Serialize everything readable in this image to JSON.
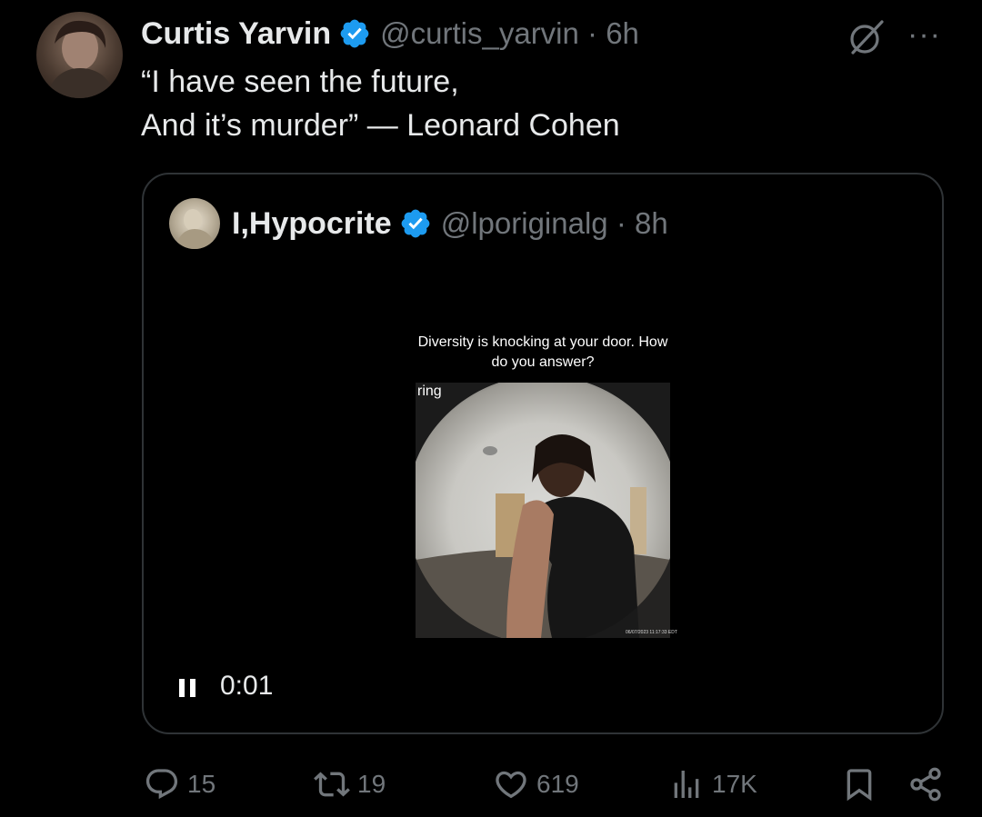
{
  "tweet": {
    "author_name": "Curtis Yarvin",
    "handle_time": "@curtis_yarvin · 6h",
    "text_lines": [
      "“I have seen the future,",
      "And it’s murder” — Leonard Cohen"
    ]
  },
  "quoted": {
    "author_name": "I,Hypocrite",
    "handle_time": "@lporiginalg · 8h",
    "video_caption": "Diversity is knocking at your door. How do you answer?",
    "video_brand": "ring",
    "video_timestamp": "06/07/2023 11:17:33 EDT",
    "playback_time": "0:01"
  },
  "actions": {
    "replies": "15",
    "reposts": "19",
    "likes": "619",
    "views": "17K"
  },
  "colors": {
    "verified": "#1d9bf0",
    "muted_text": "#71767b",
    "border": "#2f3336"
  },
  "icons": [
    "grok-icon",
    "more-icon",
    "verified-icon",
    "pause-icon",
    "reply-icon",
    "repost-icon",
    "like-icon",
    "views-icon",
    "bookmark-icon",
    "share-icon"
  ]
}
